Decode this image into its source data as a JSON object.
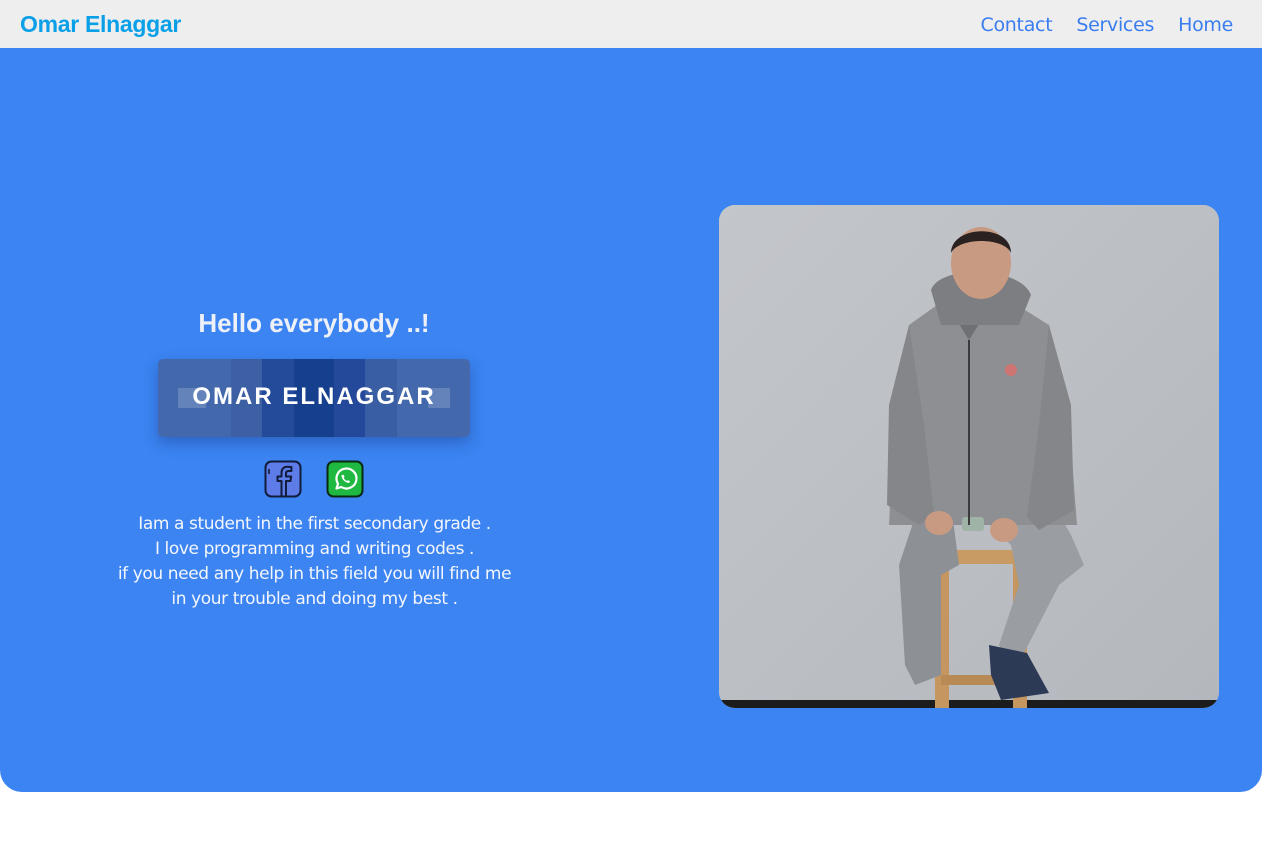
{
  "nav": {
    "brand": "Omar Elnaggar",
    "links": [
      "Contact",
      "Services",
      "Home"
    ]
  },
  "hero": {
    "greeting": "Hello everybody ..!",
    "name": "OMAR ELNAGGAR",
    "social": [
      {
        "icon": "facebook-icon"
      },
      {
        "icon": "whatsapp-icon"
      }
    ],
    "bio_lines": [
      "Iam a student in the first secondary grade .",
      "I love programming and writing codes .",
      "if you need any help in this field you will find me",
      "in your trouble and doing my best ."
    ]
  },
  "colors": {
    "brand": "#0aa0e8",
    "nav_link": "#3a7df0",
    "navbar_bg": "#eeeeee",
    "hero_bg": "#3b84f2",
    "whatsapp": "#1fb841"
  }
}
